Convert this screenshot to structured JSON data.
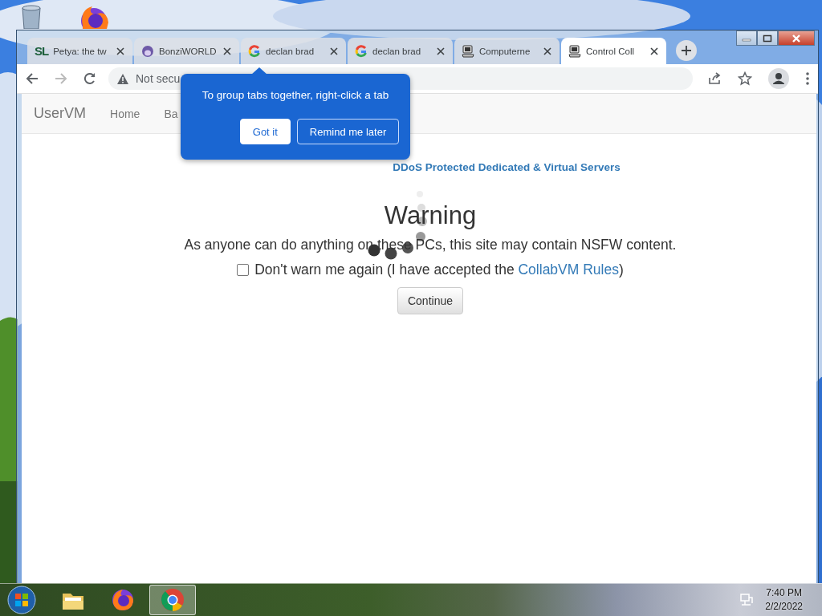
{
  "browser": {
    "tabs": [
      {
        "title": "Petya: the tw",
        "kind": "text",
        "favicon_text": "SL",
        "selected": false
      },
      {
        "title": "BonziWORLD",
        "kind": "ape",
        "selected": false
      },
      {
        "title": "declan brad",
        "kind": "google",
        "selected": false
      },
      {
        "title": "declan brad",
        "kind": "google",
        "selected": false
      },
      {
        "title": "Computerne",
        "kind": "computer",
        "selected": false
      },
      {
        "title": "Control Coll",
        "kind": "computer",
        "selected": true
      }
    ],
    "nav_buttons": [
      {
        "kind": "back",
        "disabled": false
      },
      {
        "kind": "forward",
        "disabled": true
      },
      {
        "kind": "reload",
        "disabled": false
      }
    ],
    "address": {
      "security_label": "Not secu"
    },
    "popup": {
      "text": "To group tabs together, right-click a tab",
      "buttons": [
        {
          "label": "Got it",
          "kind": "primary"
        },
        {
          "label": "Remind me later",
          "kind": "secondary"
        }
      ]
    }
  },
  "page": {
    "brand": "UserVM",
    "nav": [
      "Home",
      "Ba"
    ],
    "sponsor": "DDoS Protected Dedicated & Virtual Servers",
    "heading": "Warning",
    "message": "As anyone can do anything on these PCs, this site may contain NSFW content.",
    "checkbox": {
      "label": "Don't warn me again (I have accepted the ",
      "link": "CollabVM Rules",
      "suffix": ")",
      "checked": false
    },
    "button": "Continue"
  },
  "taskbar": {
    "apps": [
      {
        "kind": "explorer",
        "active": false
      },
      {
        "kind": "firefox",
        "active": false
      },
      {
        "kind": "chrome",
        "active": true
      }
    ],
    "time": "7:40 PM",
    "date": "2/2/2022"
  }
}
